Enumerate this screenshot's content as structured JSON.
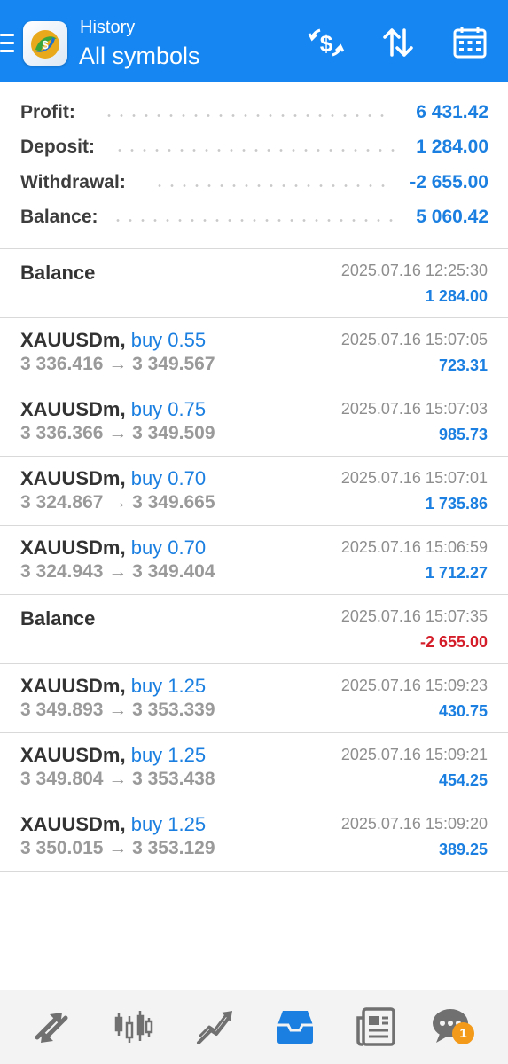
{
  "header": {
    "subtitle": "History",
    "title": "All symbols",
    "icons": [
      "menu-icon",
      "metatrader-logo",
      "currency-exchange-icon",
      "sort-icon",
      "calendar-icon"
    ]
  },
  "summary": {
    "profit": {
      "label": "Profit:",
      "value": "6 431.42"
    },
    "deposit": {
      "label": "Deposit:",
      "value": "1 284.00"
    },
    "withdrawal": {
      "label": "Withdrawal:",
      "value": "-2 655.00"
    },
    "balance": {
      "label": "Balance:",
      "value": "5 060.42"
    }
  },
  "deals": [
    {
      "kind": "balance",
      "title": "Balance",
      "time": "2025.07.16 12:25:30",
      "amount": "1 284.00"
    },
    {
      "kind": "trade",
      "symbol": "XAUUSDm,",
      "type": "buy 0.55",
      "prices": "3 336.416 → 3 349.567",
      "time": "2025.07.16 15:07:05",
      "amount": "723.31"
    },
    {
      "kind": "trade",
      "symbol": "XAUUSDm,",
      "type": "buy 0.75",
      "prices": "3 336.366 → 3 349.509",
      "time": "2025.07.16 15:07:03",
      "amount": "985.73"
    },
    {
      "kind": "trade",
      "symbol": "XAUUSDm,",
      "type": "buy 0.70",
      "prices": "3 324.867 → 3 349.665",
      "time": "2025.07.16 15:07:01",
      "amount": "1 735.86"
    },
    {
      "kind": "trade",
      "symbol": "XAUUSDm,",
      "type": "buy 0.70",
      "prices": "3 324.943 → 3 349.404",
      "time": "2025.07.16 15:06:59",
      "amount": "1 712.27"
    },
    {
      "kind": "balance",
      "title": "Balance",
      "time": "2025.07.16 15:07:35",
      "amount": "-2 655.00"
    },
    {
      "kind": "trade",
      "symbol": "XAUUSDm,",
      "type": "buy 1.25",
      "prices": "3 349.893 → 3 353.339",
      "time": "2025.07.16 15:09:23",
      "amount": "430.75"
    },
    {
      "kind": "trade",
      "symbol": "XAUUSDm,",
      "type": "buy 1.25",
      "prices": "3 349.804 → 3 353.438",
      "time": "2025.07.16 15:09:21",
      "amount": "454.25"
    },
    {
      "kind": "trade",
      "symbol": "XAUUSDm,",
      "type": "buy 1.25",
      "prices": "3 350.015 → 3 353.129",
      "time": "2025.07.16 15:09:20",
      "amount": "389.25"
    }
  ],
  "bottom_nav": {
    "items": [
      "quotes-icon",
      "chart-icon",
      "trade-icon",
      "history-icon",
      "news-icon",
      "chat-icon"
    ],
    "active": "history-icon",
    "chat_badge": "1"
  },
  "colors": {
    "header_bg": "#1687f2",
    "positive": "#1a7fe0",
    "negative": "#d41f2b",
    "badge": "#f39a1a"
  }
}
